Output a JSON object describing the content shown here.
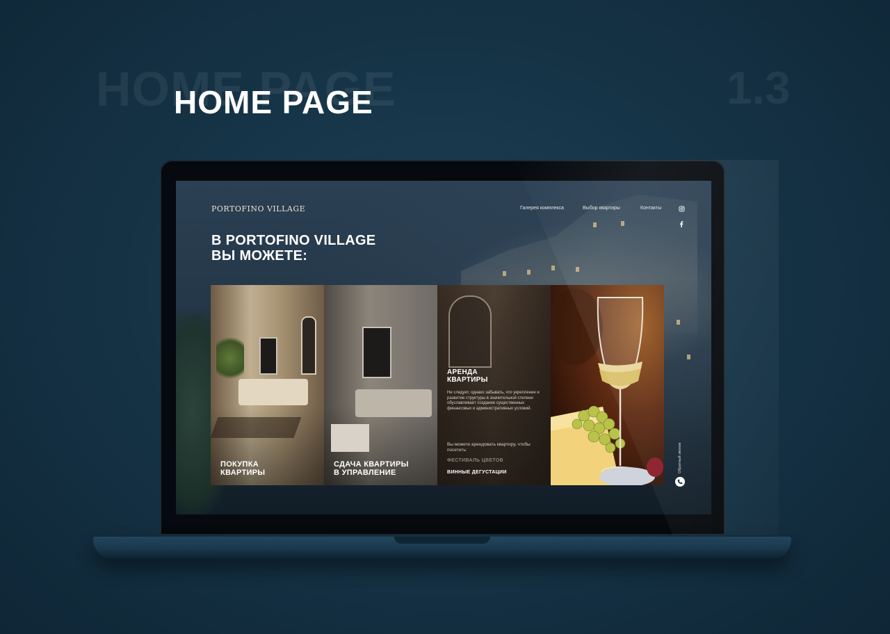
{
  "presentation": {
    "ghost_title": "HOME PAGE",
    "ghost_number": "1.3",
    "title": "HOME PAGE"
  },
  "site": {
    "logo": "PORTOFINO VILLAGE",
    "nav": [
      "Галерея комплекса",
      "Выбор квартиры",
      "Контакты"
    ],
    "social_icons": [
      "instagram-icon",
      "facebook-icon"
    ],
    "hero_line1": "В PORTOFINO VILLAGE",
    "hero_line2": "ВЫ МОЖЕТЕ:",
    "cards": [
      {
        "label_line1": "ПОКУПКА",
        "label_line2": "КВАРТИРЫ"
      },
      {
        "label_line1": "СДАЧА КВАРТИРЫ",
        "label_line2": "В УПРАВЛЕНИЕ"
      },
      {
        "title_line1": "АРЕНДА",
        "title_line2": "КВАРТИРЫ",
        "description": "Не следует, однако забывать, что укрепление и развитие структуры в значительной степени обуславливает создание существенных финансовых и административных условий.",
        "description2": "Вы можете арендовать квартиру, чтобы посетить:",
        "link1": "ФЕСТИВАЛЬ ЦВЕТОВ",
        "link2": "ВИННЫЕ ДЕГУСТАЦИИ"
      },
      {
        "image": "wine-glass-cheese-grapes"
      }
    ],
    "callback_label": "Обратный звонок"
  }
}
